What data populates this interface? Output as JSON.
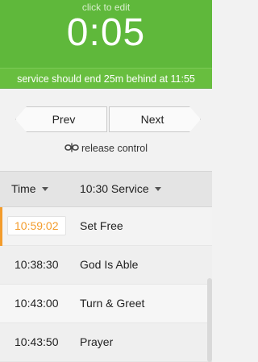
{
  "timer": {
    "hint": "click to edit",
    "value": "0:05",
    "status": "service should end 25m behind at 11:55",
    "color": "#5fb83b"
  },
  "controls": {
    "prev_label": "Prev",
    "next_label": "Next",
    "release_label": "release control",
    "release_icon": "unlink-icon"
  },
  "table": {
    "col_time": "Time",
    "col_service": "10:30 Service",
    "rows": [
      {
        "time": "10:59:02",
        "name": "Set Free"
      },
      {
        "time": "10:38:30",
        "name": "God Is Able"
      },
      {
        "time": "10:43:00",
        "name": "Turn & Greet"
      },
      {
        "time": "10:43:50",
        "name": "Prayer"
      }
    ]
  },
  "accent": "#f39c2c"
}
